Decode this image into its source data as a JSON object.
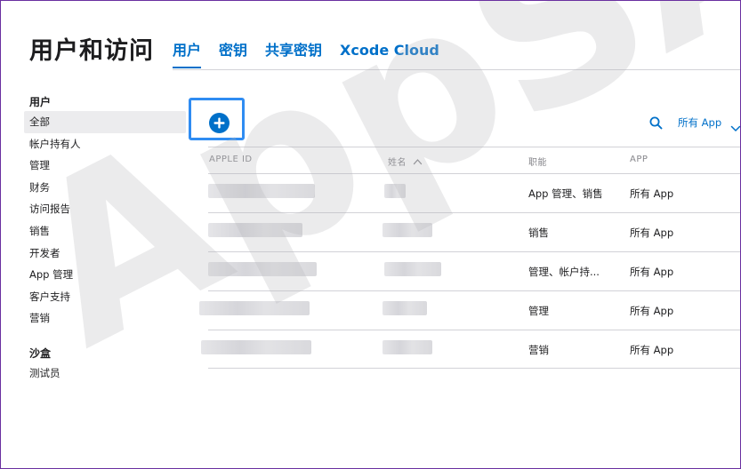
{
  "header": {
    "title": "用户和访问",
    "tabs": [
      {
        "label": "用户",
        "active": true
      },
      {
        "label": "密钥",
        "active": false
      },
      {
        "label": "共享密钥",
        "active": false
      },
      {
        "label": "Xcode Cloud",
        "active": false
      }
    ]
  },
  "sidebar": {
    "sections": [
      {
        "heading": "用户",
        "items": [
          "全部",
          "帐户持有人",
          "管理",
          "财务",
          "访问报告",
          "销售",
          "开发者",
          "App 管理",
          "客户支持",
          "营销"
        ],
        "active_index": 0
      },
      {
        "heading": "沙盒",
        "items": [
          "测试员"
        ]
      }
    ]
  },
  "toolbar": {
    "add_icon": "plus-circle-icon",
    "search_icon": "search-icon",
    "filter_label": "所有 App",
    "filter_icon": "chevron-down-icon"
  },
  "table": {
    "columns": {
      "apple_id": "APPLE ID",
      "name": "姓名",
      "name_sort_icon": "chevron-up-icon",
      "role": "职能",
      "app": "APP"
    },
    "rows": [
      {
        "role": "App 管理、销售",
        "app": "所有 App"
      },
      {
        "role": "销售",
        "app": "所有 App"
      },
      {
        "role": "管理、帐户持...",
        "app": "所有 App"
      },
      {
        "role": "管理",
        "app": "所有 App"
      },
      {
        "role": "营销",
        "app": "所有 App"
      }
    ]
  },
  "watermark": {
    "text": "AppSA"
  },
  "colors": {
    "accent": "#0070c9",
    "highlight_border": "#2f8cf2",
    "frame_border": "#6a2fa0"
  }
}
